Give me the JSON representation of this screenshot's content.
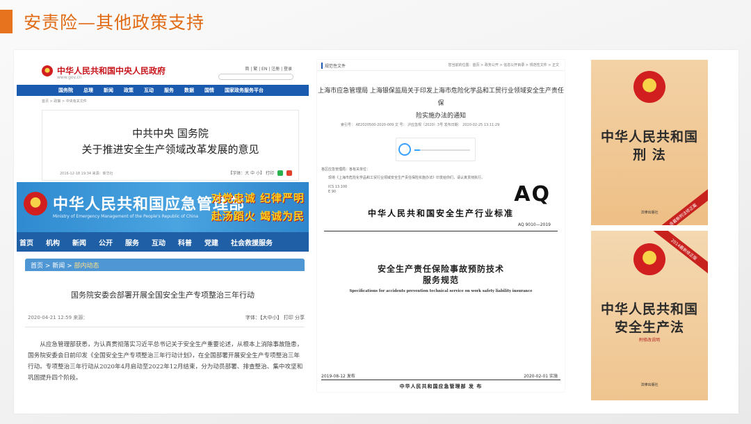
{
  "slide": {
    "title": "安责险—其他政策支持"
  },
  "gov_cn": {
    "site_name": "中华人民共和国中央人民政府",
    "url": "www.gov.cn",
    "top_links": "简 | 繁 | EN | 注册 | 登录",
    "nav": [
      "国务院",
      "总理",
      "新闻",
      "政策",
      "互动",
      "服务",
      "数据",
      "国情",
      "国家政务服务平台"
    ],
    "breadcrumb": "首页 > 政策 > 中央有关文件",
    "doc_title_line1": "中共中央 国务院",
    "doc_title_line2": "关于推进安全生产领域改革发展的意见",
    "meta": "2016-12-18 19:34   来源：新华社",
    "tools": "【字体：大 中 小】   打印"
  },
  "mem_gov": {
    "site_name": "中华人民共和国应急管理部",
    "site_en": "Ministry of Emergency Management of the People's Republic of China",
    "slogan_line1": "对党忠诚 纪律严明",
    "slogan_line2": "赴汤蹈火 竭诚为民",
    "nav": [
      "首页",
      "机构",
      "新闻",
      "公开",
      "服务",
      "互动",
      "科普",
      "党建",
      "社会救援服务"
    ],
    "crumb_prefix": "首页 > 新闻 > ",
    "crumb_current": "部内动态",
    "article_title": "国务院安委会部署开展全国安全生产专项整治三年行动",
    "meta": "2020-04-21 12:59     来源：",
    "tools": "字体：【大中小】    打印    分享",
    "body": "从应急管理部获悉，为认真贯彻落实习近平总书记关于安全生产重要论述，从根本上消除事故隐患，国务院安委会日前印发《全国安全生产专项整治三年行动计划》，在全国部署开展安全生产专项整治三年行动。专项整治三年行动从2020年4月启动至2022年12月结束，分为动员部署、排查整治、集中攻坚和巩固提升四个阶段。"
  },
  "sh_doc": {
    "label": "规范性文件",
    "location": "您当前的位置：首页 > 政务公开 > 信息公开目录 > 规范性文件 > 正文",
    "title_line1": "上海市应急管理局 上海银保监局关于印发上海市危险化学品和工贸行业领域安全生产责任保",
    "title_line2": "险实施办法的通知",
    "meta": "索引号：  AE2020500-2020-009        文    号：  沪应急规〔2020〕3号        发布日期：  2020-02-25 13:11:29",
    "audio_progress": 0.1,
    "small1": "各区应急管理局：各有关单位：",
    "small2": "现将《上海市危险化学品和工贸行业领域安全生产责任保险实施办法》印发给你们，请认真贯彻执行。"
  },
  "aq_standard": {
    "ics": "ICS 13.100\nE 90",
    "mark": "AQ",
    "org": "中华人民共和国安全生产行业标准",
    "code": "AQ 9010—2019",
    "title_line1": "安全生产责任保险事故预防技术",
    "title_line2": "服务规范",
    "title_en": "Specifications for accidents prevention technical service on work safety liability insurance",
    "release_date": "2019-08-12 发布",
    "impl_date": "2020-02-01 实施",
    "publisher": "中华人民共和国应急管理部     发 布"
  },
  "books": [
    {
      "line1": "中华人民共和国",
      "line2": "刑  法",
      "tag": "含最新刑法修正案",
      "publisher": "法律出版社"
    },
    {
      "line1": "中华人民共和国",
      "line2": "安全生产法",
      "tag": "2014最新修正版",
      "subtitle": "附修改说明",
      "publisher": "法律出版社"
    }
  ],
  "colors": {
    "accent": "#e8731e",
    "gov_blue": "#1b5baf",
    "mem_blue": "#2f8ad0",
    "red": "#c8161d"
  }
}
